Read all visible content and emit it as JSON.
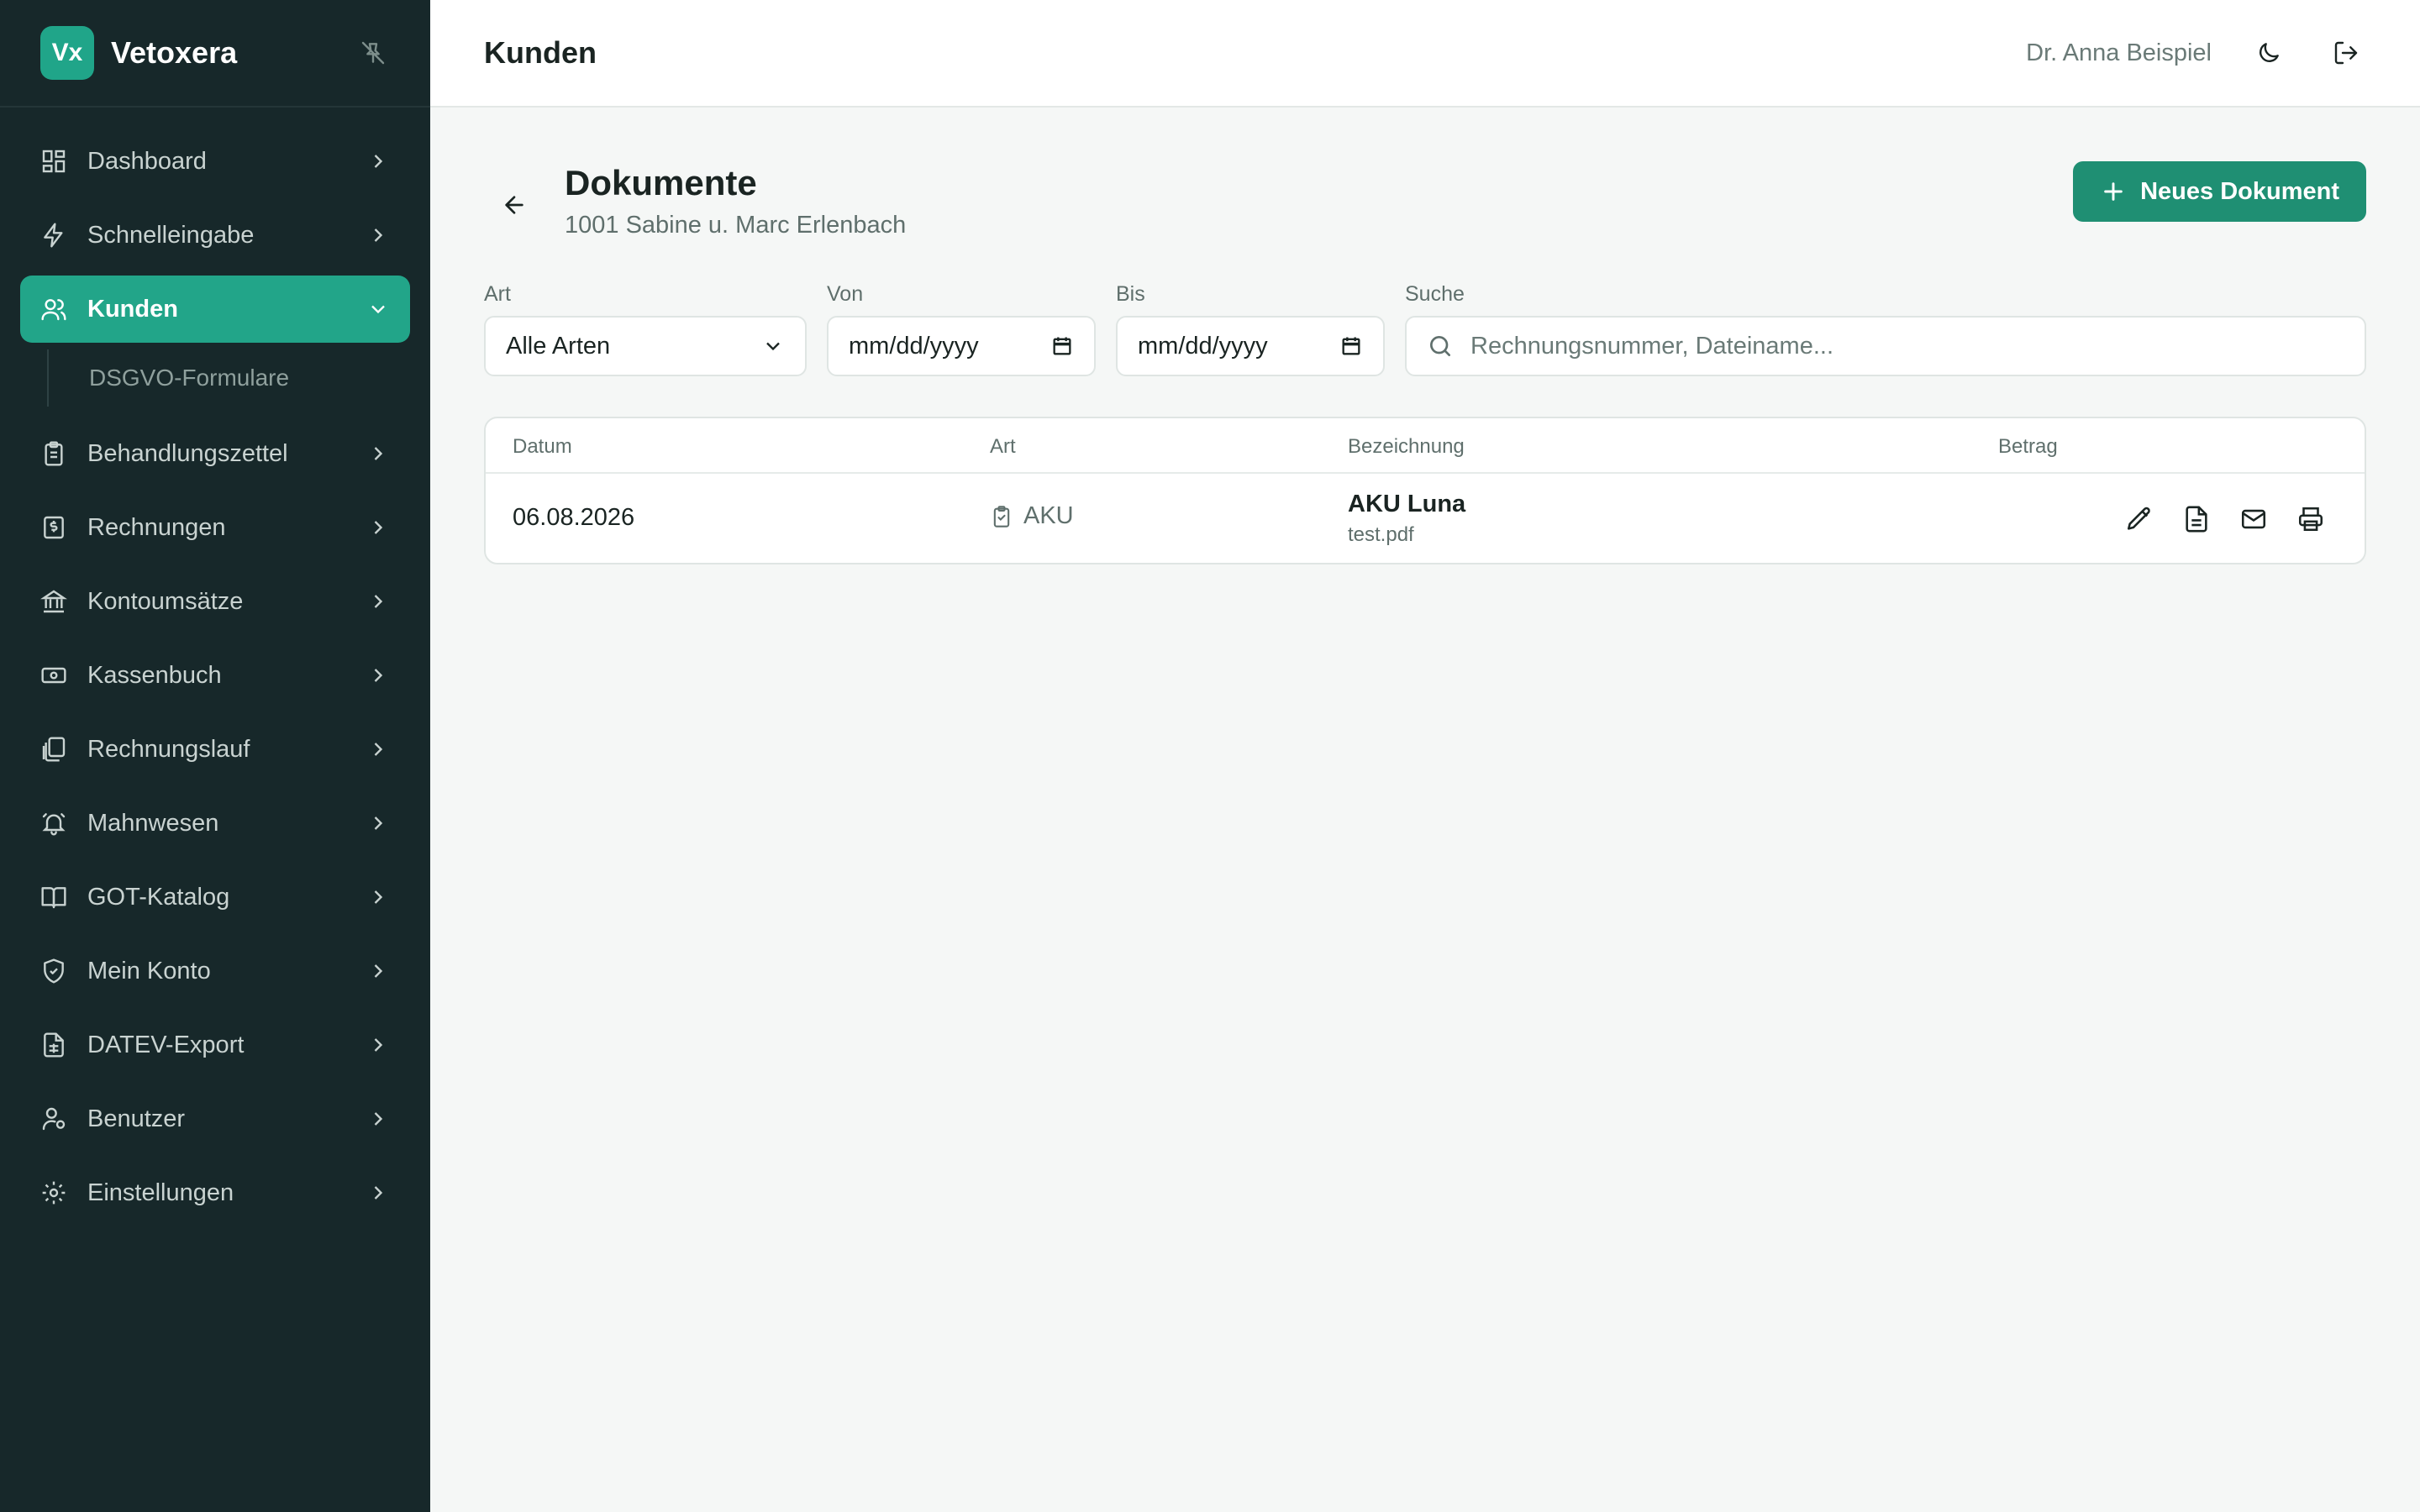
{
  "app": {
    "logo_text": "Vx",
    "name": "Vetoxera"
  },
  "sidebar": {
    "items": [
      {
        "label": "Dashboard",
        "icon": "dashboard-icon"
      },
      {
        "label": "Schnelleingabe",
        "icon": "lightning-icon"
      },
      {
        "label": "Kunden",
        "icon": "users-icon",
        "active": true
      },
      {
        "label": "Behandlungszettel",
        "icon": "clipboard-icon"
      },
      {
        "label": "Rechnungen",
        "icon": "invoice-icon"
      },
      {
        "label": "Kontoumsätze",
        "icon": "bank-icon"
      },
      {
        "label": "Kassenbuch",
        "icon": "cash-icon"
      },
      {
        "label": "Rechnungslauf",
        "icon": "documents-stack-icon"
      },
      {
        "label": "Mahnwesen",
        "icon": "bell-icon"
      },
      {
        "label": "GOT-Katalog",
        "icon": "book-icon"
      },
      {
        "label": "Mein Konto",
        "icon": "shield-icon"
      },
      {
        "label": "DATEV-Export",
        "icon": "spreadsheet-icon"
      },
      {
        "label": "Benutzer",
        "icon": "user-settings-icon"
      },
      {
        "label": "Einstellungen",
        "icon": "gear-icon"
      }
    ],
    "sub_items": [
      {
        "label": "DSGVO-Formulare"
      }
    ]
  },
  "topbar": {
    "title": "Kunden",
    "user": "Dr. Anna Beispiel"
  },
  "page": {
    "title": "Dokumente",
    "subtitle": "1001 Sabine u. Marc Erlenbach",
    "new_button": "Neues Dokument"
  },
  "filters": {
    "art_label": "Art",
    "art_value": "Alle Arten",
    "von_label": "Von",
    "von_placeholder": "mm/dd/yyyy",
    "bis_label": "Bis",
    "bis_placeholder": "mm/dd/yyyy",
    "suche_label": "Suche",
    "suche_placeholder": "Rechnungsnummer, Dateiname..."
  },
  "table": {
    "headers": {
      "datum": "Datum",
      "art": "Art",
      "bezeichnung": "Bezeichnung",
      "betrag": "Betrag"
    },
    "rows": [
      {
        "datum": "06.08.2026",
        "art": "AKU",
        "bezeichnung": "AKU Luna",
        "datei": "test.pdf",
        "betrag": ""
      }
    ]
  },
  "colors": {
    "sidebar_bg": "#17282a",
    "accent": "#22a589",
    "primary_button": "#1f8f73"
  }
}
